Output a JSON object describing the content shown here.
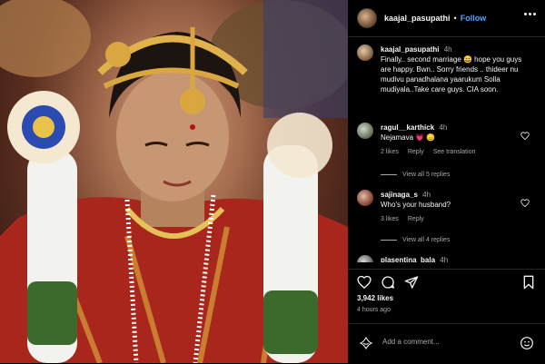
{
  "post": {
    "username": "kaajal_pasupathi",
    "follow_label": "Follow",
    "likes": "3,942 likes",
    "posted_time": "4 hours ago",
    "comment_placeholder": "Add a comment...",
    "more_icon": "more-horizontal-icon",
    "photo_description_icons": [
      "bride-garland",
      "gold-headpiece"
    ]
  },
  "caption": {
    "username": "kaajal_pasupathi",
    "time": "4h",
    "text": "Finally.. second marriage 😄 hope you guys are happy. Bwn.. Sorry friends .. thideer nu mudivu panadhalana yaarukum Solla mudiyala..Take care guys. CIA soon."
  },
  "comments": [
    {
      "username": "ragul__karthick",
      "time": "4h",
      "text": "Nejamava 💗 😞",
      "likes": "2 likes",
      "reply": "Reply",
      "translate": "See translation",
      "view_replies": "View all 5 replies"
    },
    {
      "username": "sajinaga_s",
      "time": "4h",
      "text": "Who's your husband?",
      "likes": "3 likes",
      "reply": "Reply",
      "view_replies": "View all 4 replies"
    },
    {
      "username": "plasentina_bala",
      "time": "4h"
    }
  ],
  "colors": {
    "background": "#000000",
    "accent": "#4aa3ff",
    "muted": "#a8a8a8",
    "divider": "#262626"
  }
}
